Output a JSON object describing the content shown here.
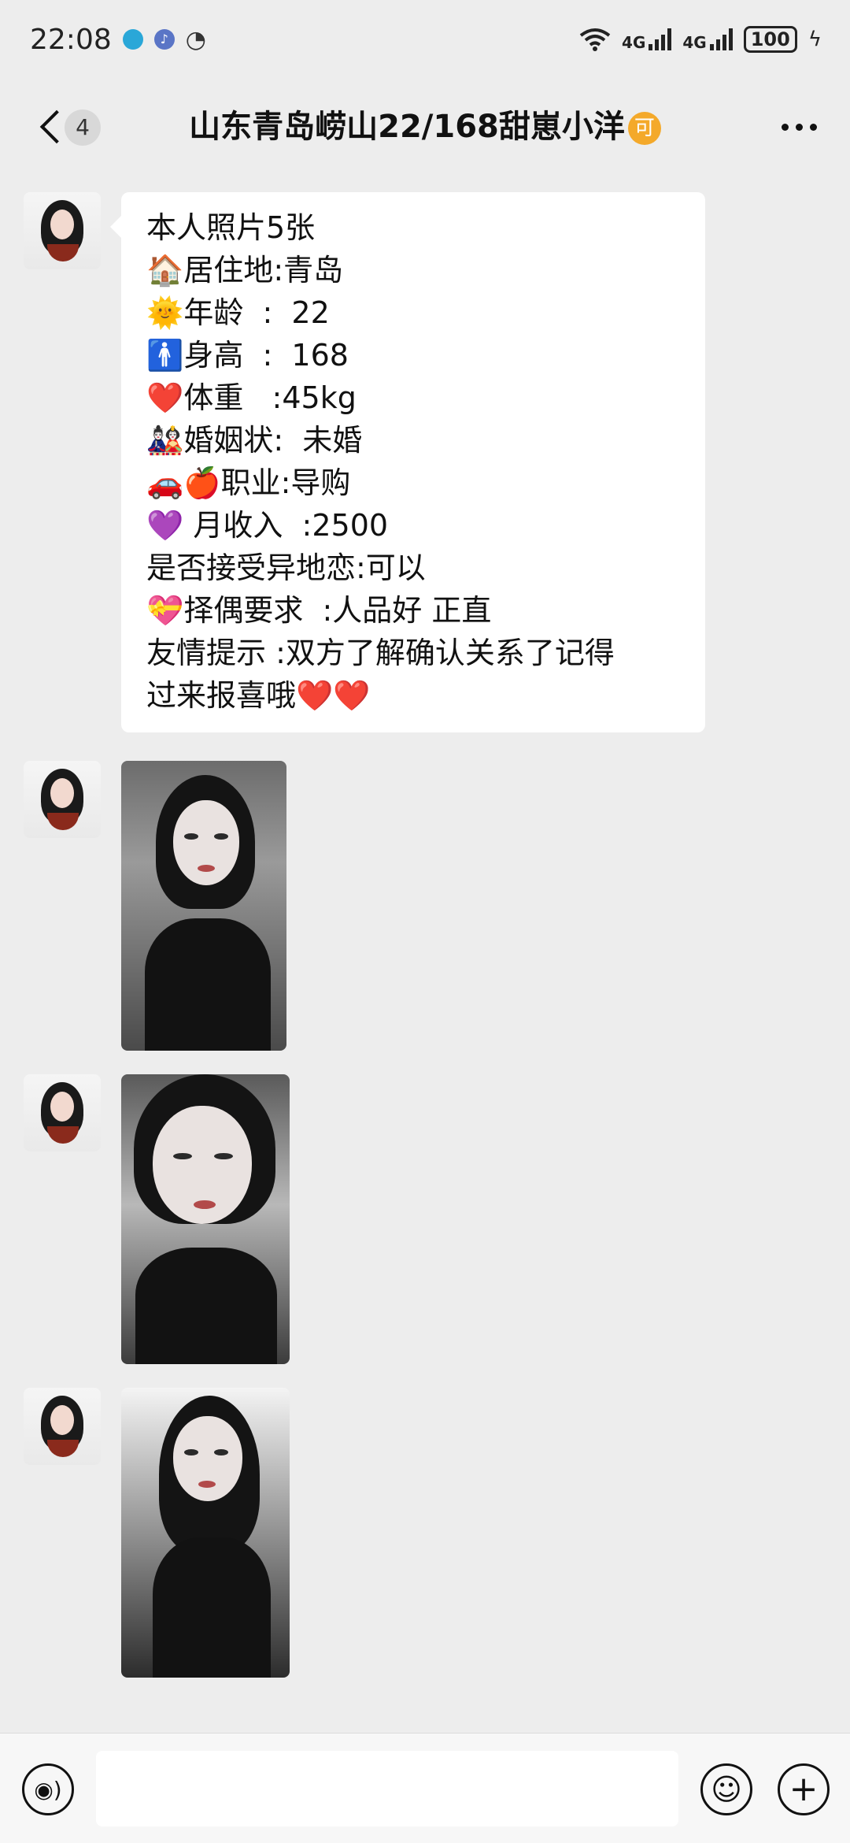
{
  "status_bar": {
    "time": "22:08",
    "network_1": "4G",
    "network_2": "4G",
    "battery": "100",
    "icons": [
      "browser-icon",
      "music-icon",
      "speedometer-icon",
      "wifi-icon",
      "signal-icon",
      "battery-icon",
      "charging-icon"
    ]
  },
  "header": {
    "unread_count": "4",
    "title": "山东青岛崂山22/168甜崽小洋",
    "title_badge": "可"
  },
  "messages": {
    "text_lines": [
      "本人照片5张",
      "🏠居住地:青岛",
      "🌞年龄  :  22",
      "🚹身高  :  168",
      "❤️体重   :45kg",
      "🎎婚姻状:  未婚",
      "🚗🍎职业:导购",
      "💜 月收入  :2500",
      "是否接受异地恋:可以",
      "💝择偶要求  :人品好 正直",
      "友情提示 :双方了解确认关系了记得",
      "过来报喜哦❤️❤️"
    ]
  },
  "input_bar": {
    "placeholder": "",
    "icons": [
      "voice-icon",
      "emoji-icon",
      "plus-icon"
    ]
  }
}
